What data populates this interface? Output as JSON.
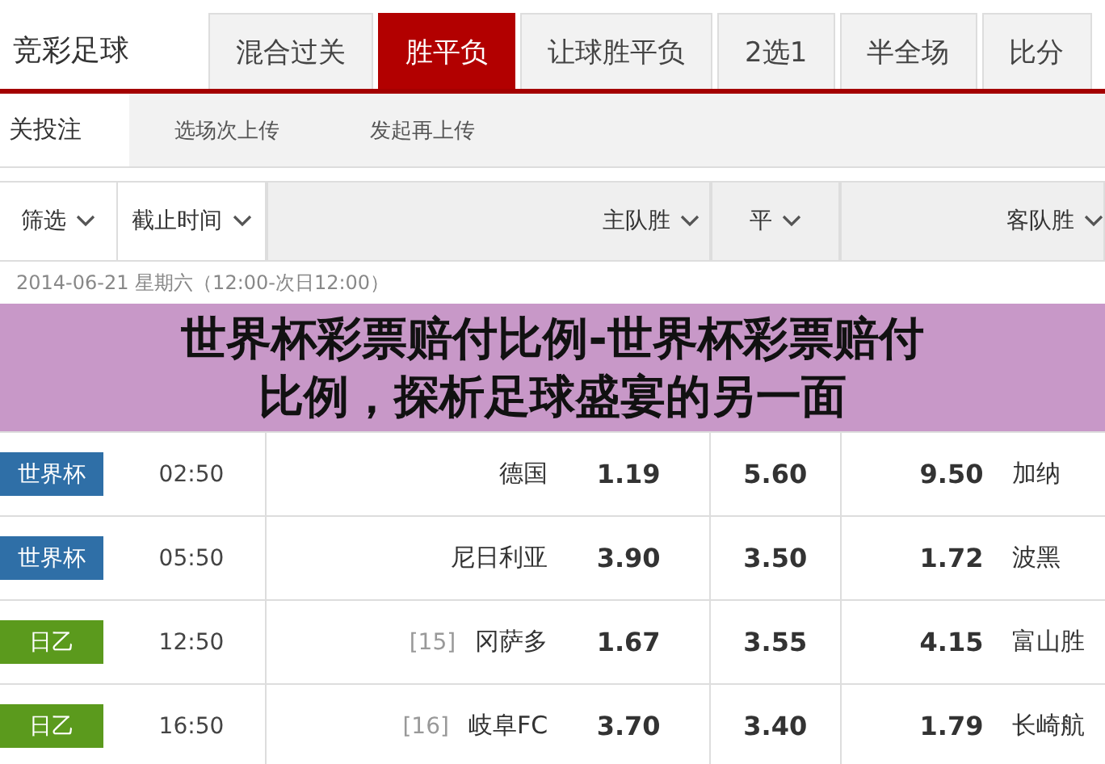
{
  "top_nav": {
    "brand": "竞彩足球",
    "tabs": [
      {
        "label": "混合过关",
        "selected": false
      },
      {
        "label": "胜平负",
        "selected": true
      },
      {
        "label": "让球胜平负",
        "selected": false
      },
      {
        "label": "2选1",
        "selected": false
      },
      {
        "label": "半全场",
        "selected": false
      },
      {
        "label": "比分",
        "selected": false
      }
    ]
  },
  "sub_tabs": [
    {
      "label": "关投注",
      "selected": true
    },
    {
      "label": "选场次上传",
      "selected": false
    },
    {
      "label": "发起再上传",
      "selected": false
    }
  ],
  "table": {
    "columns": [
      "筛选",
      "截止时间",
      "主队胜",
      "平",
      "客队胜"
    ],
    "date_line": "2014-06-21 星期六（12:00-次日12:00）",
    "rows": [
      {
        "league": "世界杯",
        "color": "#2f6fa7",
        "time": "02:50",
        "home": "德国",
        "home_odds": "1.19",
        "draw_odds": "5.60",
        "away_odds": "9.50",
        "away": "加纳"
      },
      {
        "league": "世界杯",
        "color": "#2f6fa7",
        "time": "05:50",
        "home": "尼日利亚",
        "home_odds": "3.90",
        "draw_odds": "3.50",
        "away_odds": "1.72",
        "away": "波黑"
      },
      {
        "league": "日乙",
        "color": "#5b9a1d",
        "time": "12:50",
        "rank": "[15]",
        "home": "冈萨多",
        "home_odds": "1.67",
        "draw_odds": "3.55",
        "away_odds": "4.15",
        "away": "富山胜"
      },
      {
        "league": "日乙",
        "color": "#5b9a1d",
        "time": "16:50",
        "rank": "[16]",
        "home": "岐阜FC",
        "home_odds": "3.70",
        "draw_odds": "3.40",
        "away_odds": "1.79",
        "away": "长崎航"
      }
    ]
  },
  "banner": {
    "title": "世界杯彩票赔付比例-世界杯彩票赔付比例，探析足球盛宴的另一面"
  }
}
